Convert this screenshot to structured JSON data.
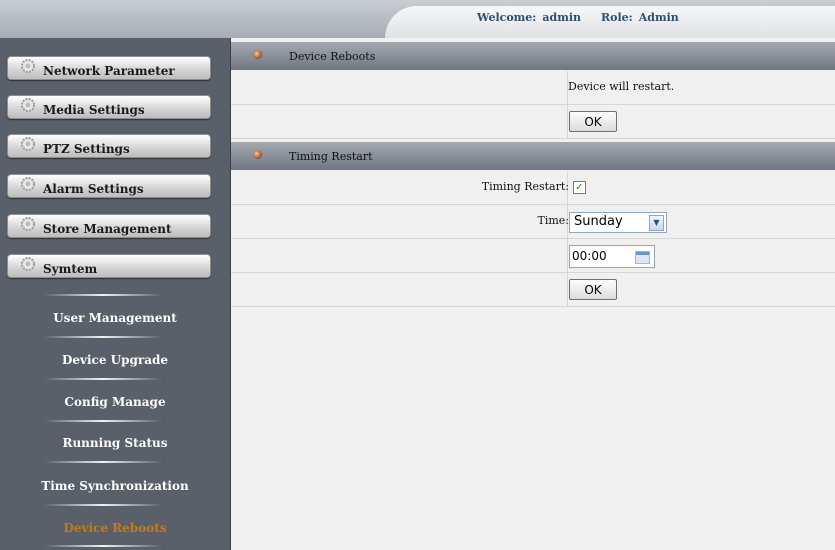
{
  "header": {
    "welcome_label": "Welcome:",
    "username": "admin",
    "role_label": "Role:",
    "role": "Admin"
  },
  "sidebar": {
    "menus": [
      {
        "label": "Network Parameter",
        "icon": "gear-icon"
      },
      {
        "label": "Media Settings",
        "icon": "gear-icon"
      },
      {
        "label": "PTZ Settings",
        "icon": "gear-icon"
      },
      {
        "label": "Alarm Settings",
        "icon": "gear-icon"
      },
      {
        "label": "Store Management",
        "icon": "gear-icon"
      },
      {
        "label": "Symtem",
        "icon": "gear-icon"
      }
    ],
    "submenu": [
      {
        "label": "User Management"
      },
      {
        "label": "Device Upgrade"
      },
      {
        "label": "Config Manage"
      },
      {
        "label": "Running Status"
      },
      {
        "label": "Time Synchronization"
      },
      {
        "label": "Device Reboots",
        "active": true
      }
    ],
    "active_color": "#c57b16"
  },
  "main": {
    "reboot": {
      "title": "Device Reboots",
      "message": "Device will restart.",
      "ok_label": "OK"
    },
    "timing": {
      "title": "Timing Restart",
      "enable_label": "Timing Restart:",
      "enabled": true,
      "time_label": "Time:",
      "day": "Sunday",
      "time_value": "00:00",
      "ok_label": "OK"
    }
  }
}
